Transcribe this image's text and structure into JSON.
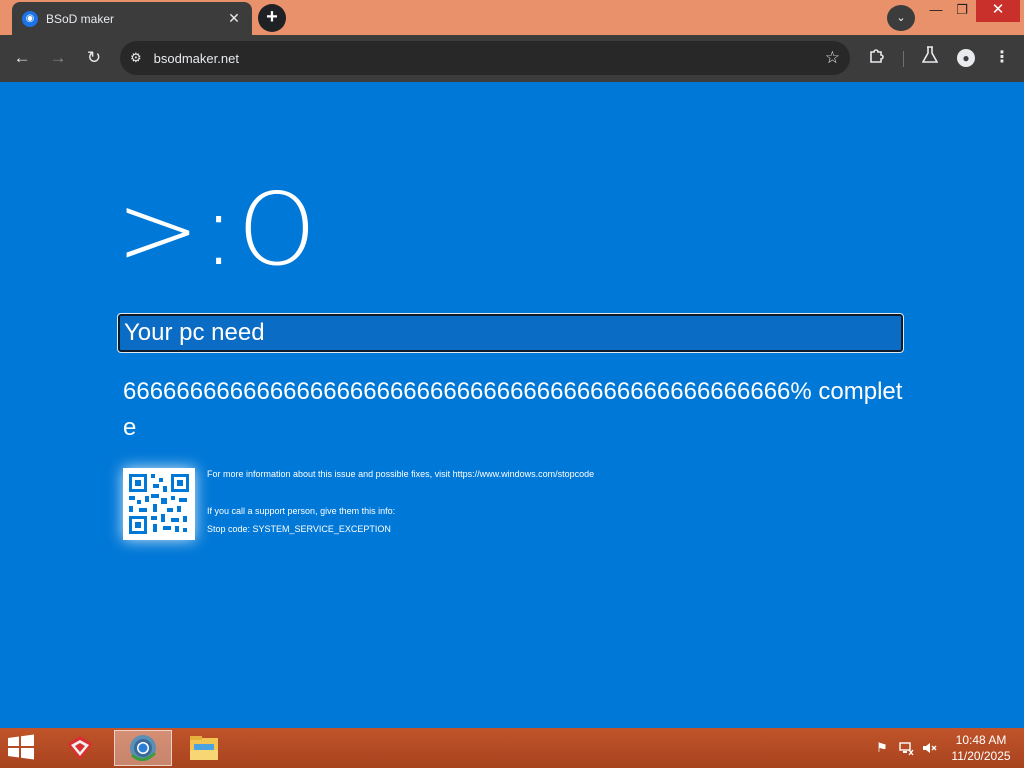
{
  "browser": {
    "tab": {
      "title": "BSoD maker",
      "favicon": "sound-wave-icon"
    },
    "new_tab_symbol": "+",
    "window_controls": {
      "minimize": "—",
      "maximize": "❐",
      "close": "✕"
    },
    "toolbar": {
      "back_symbol": "←",
      "forward_symbol": "→",
      "reload_symbol": "↻",
      "url": "bsodmaker.net",
      "star_symbol": "☆",
      "menu_symbol": "⋮"
    }
  },
  "bsod": {
    "background_color": "#0078d7",
    "face": ">:O",
    "message_input_value": "Your pc need",
    "progress_text": "66666666666666666666666666666666666666666666666666% complete",
    "info_line_1": "For more information about this issue and possible fixes, visit https://www.windows.com/stopcode",
    "info_line_2": "If you call a support person, give them this info:",
    "info_line_3": "Stop code: SYSTEM_SERVICE_EXCEPTION"
  },
  "taskbar": {
    "color": "#b04a22",
    "apps": [
      "paint-app-icon",
      "chrome-icon",
      "file-explorer-icon"
    ],
    "tray_icons": [
      "action-center-flag-icon",
      "network-icon",
      "volume-muted-icon"
    ],
    "time": "10:48 AM",
    "date": "11/20/2025"
  }
}
